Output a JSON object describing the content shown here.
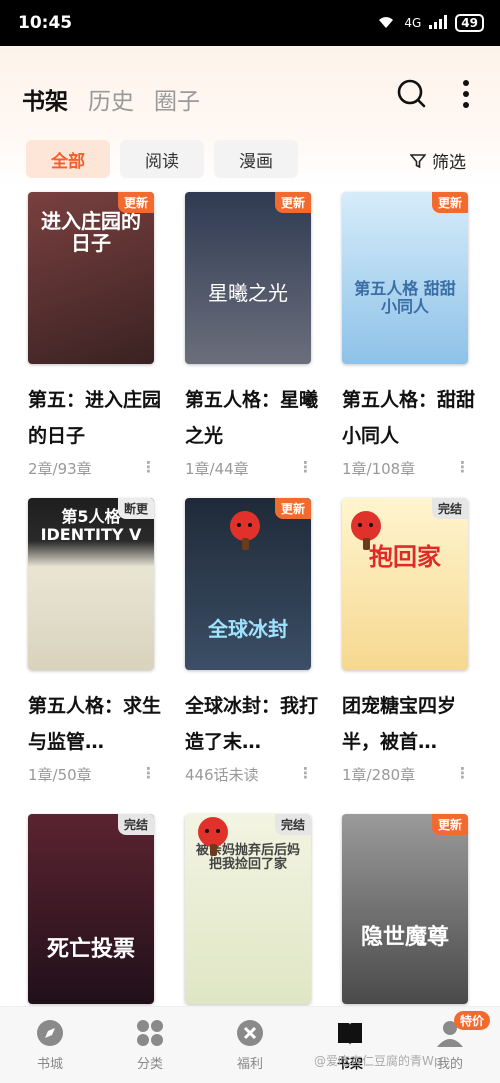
{
  "status": {
    "time": "10:45",
    "network": "4G",
    "battery": "49"
  },
  "header": {
    "tabs": [
      "书架",
      "历史",
      "圈子"
    ],
    "active_tab": 0
  },
  "filters": {
    "chips": [
      "全部",
      "阅读",
      "漫画"
    ],
    "active": 0,
    "filter_label": "筛选"
  },
  "books": [
    {
      "title": "第五：进入庄园的日子",
      "meta": "2章/93章",
      "badge": "更新",
      "badge_type": "update",
      "cover_text": "进入庄园的日子",
      "bg": "#5a3a3a",
      "fg": "#ffffff"
    },
    {
      "title": "第五人格：星曦之光",
      "meta": "1章/44章",
      "badge": "更新",
      "badge_type": "update",
      "cover_text": "星曦之光",
      "bg": "#4a5468",
      "fg": "#ffffff"
    },
    {
      "title": "第五人格：甜甜小同人",
      "meta": "1章/108章",
      "badge": "更新",
      "badge_type": "update",
      "cover_text": "第五人格 甜甜小同人",
      "bg": "#a9d3ee",
      "fg": "#3a6ea5"
    },
    {
      "title": "第五人格：求生与监管…",
      "meta": "1章/50章",
      "badge": "断更",
      "badge_type": "paused",
      "cover_text": "第5人格 IDENTITY V",
      "bg": "#2a2a2a",
      "fg": "#ffffff"
    },
    {
      "title": "全球冰封：我打造了末…",
      "meta": "446话未读",
      "badge": "更新",
      "badge_type": "update",
      "cover_text": "全球冰封",
      "bg": "#2c3a4c",
      "fg": "#9fe3ff"
    },
    {
      "title": "团宠糖宝四岁半，被首…",
      "meta": "1章/280章",
      "badge": "完结",
      "badge_type": "complete",
      "cover_text": "抱回家",
      "bg": "#fbe6a8",
      "fg": "#e02a2a"
    },
    {
      "title": "",
      "meta": "",
      "badge": "完结",
      "badge_type": "complete",
      "cover_text": "死亡投票",
      "bg": "#3a1b22",
      "fg": "#ffffff"
    },
    {
      "title": "",
      "meta": "",
      "badge": "完结",
      "badge_type": "complete",
      "cover_text": "被亲妈抛弃后后妈把我捡回了家",
      "bg": "#eef0d8",
      "fg": "#444444"
    },
    {
      "title": "",
      "meta": "",
      "badge": "更新",
      "badge_type": "update",
      "cover_text": "隐世魔尊",
      "bg": "#7a7a7a",
      "fg": "#ffffff"
    }
  ],
  "nav": {
    "items": [
      {
        "label": "书城",
        "icon": "compass-icon"
      },
      {
        "label": "分类",
        "icon": "grid-icon"
      },
      {
        "label": "福利",
        "icon": "gift-icon"
      },
      {
        "label": "书架",
        "icon": "bookshelf-icon"
      },
      {
        "label": "我的",
        "icon": "profile-icon"
      }
    ],
    "active": 3,
    "badge": "特价"
  },
  "watermark": "@爱吃杏仁豆腐的青Wp",
  "colors": {
    "accent": "#f36a2e",
    "chip_active_bg": "#fde5d8"
  }
}
